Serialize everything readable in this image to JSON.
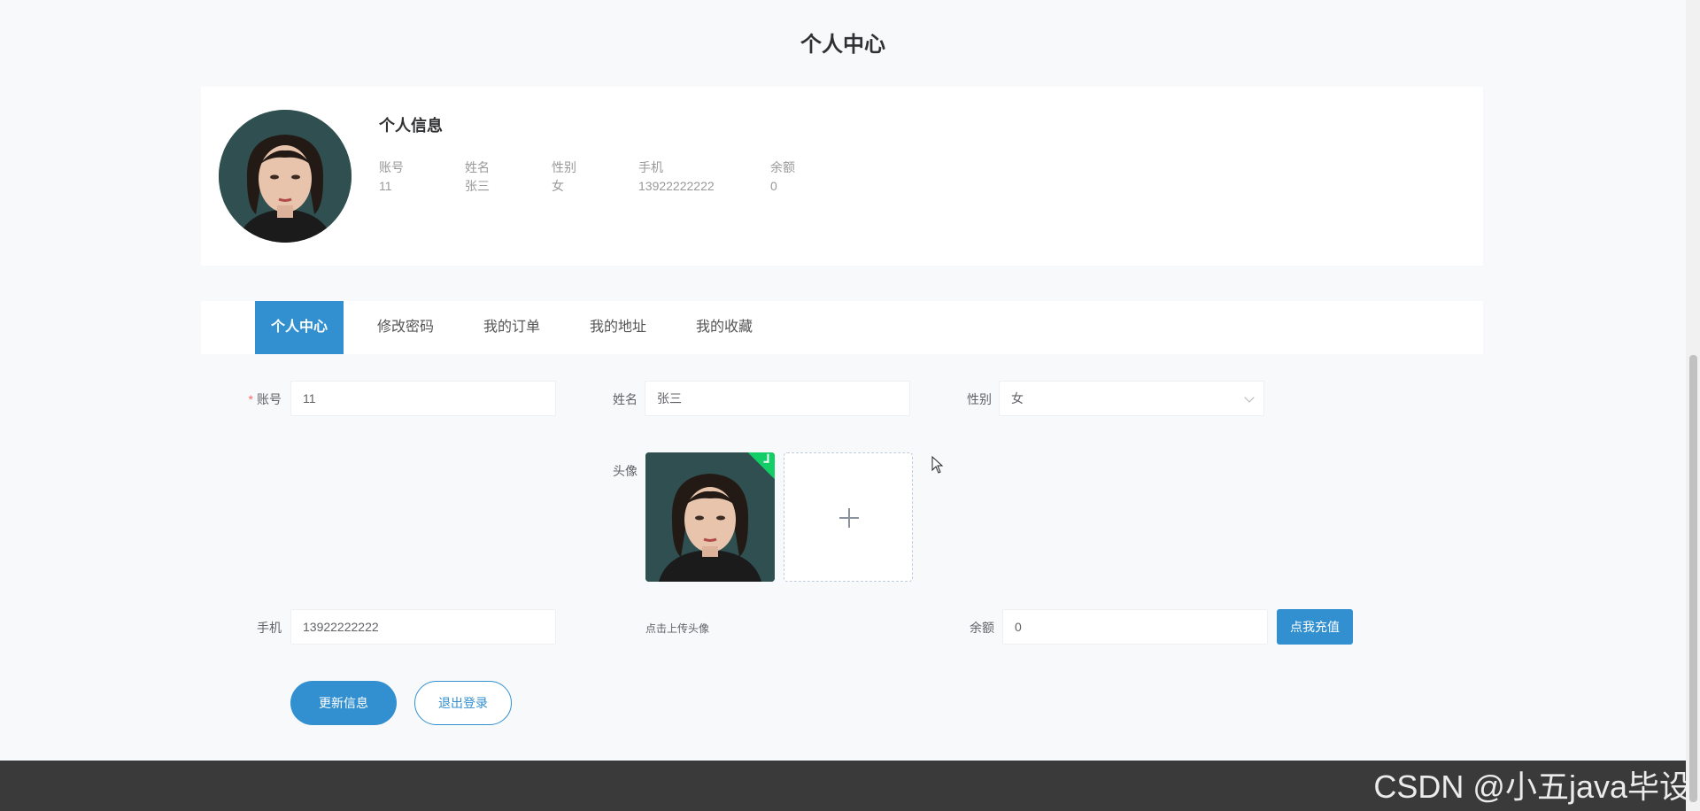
{
  "page": {
    "title": "个人中心"
  },
  "profile_card": {
    "title": "个人信息",
    "fields": [
      {
        "label": "账号",
        "value": "11"
      },
      {
        "label": "姓名",
        "value": "张三"
      },
      {
        "label": "性别",
        "value": "女"
      },
      {
        "label": "手机",
        "value": "13922222222"
      },
      {
        "label": "余额",
        "value": "0"
      }
    ]
  },
  "tabs": [
    {
      "label": "个人中心",
      "active": true
    },
    {
      "label": "修改密码",
      "active": false
    },
    {
      "label": "我的订单",
      "active": false
    },
    {
      "label": "我的地址",
      "active": false
    },
    {
      "label": "我的收藏",
      "active": false
    }
  ],
  "form": {
    "account": {
      "label": "账号",
      "required_mark": "*",
      "value": "11"
    },
    "name": {
      "label": "姓名",
      "value": "张三"
    },
    "gender": {
      "label": "性别",
      "value": "女"
    },
    "avatar": {
      "label": "头像",
      "tip": "点击上传头像",
      "upload_icon": "plus-icon",
      "uploaded_badge_icon": "check-icon"
    },
    "phone": {
      "label": "手机",
      "value": "13922222222"
    },
    "balance": {
      "label": "余额",
      "value": "0"
    },
    "recharge_button": "点我充值",
    "update_button": "更新信息",
    "logout_button": "退出登录"
  },
  "watermark": "CSDN @小五java毕设",
  "colors": {
    "primary": "#3390d0",
    "success_badge": "#13ce66",
    "required": "#f56c6c",
    "footer": "#3a3a3a"
  }
}
